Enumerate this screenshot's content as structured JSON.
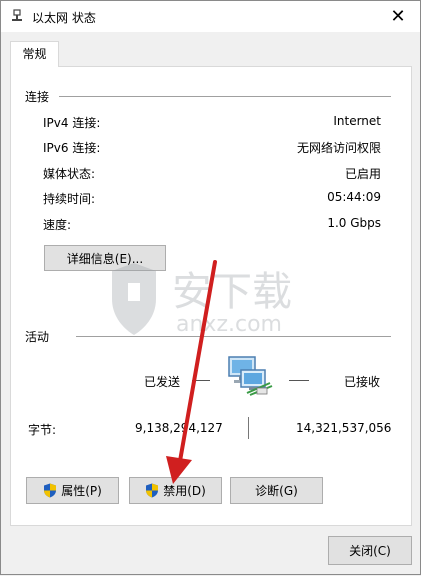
{
  "window": {
    "title": "以太网 状态",
    "close_glyph": "✕"
  },
  "tab": {
    "label": "常规"
  },
  "connection": {
    "section_title": "连接",
    "rows": [
      {
        "label": "IPv4 连接:",
        "value": "Internet"
      },
      {
        "label": "IPv6 连接:",
        "value": "无网络访问权限"
      },
      {
        "label": "媒体状态:",
        "value": "已启用"
      },
      {
        "label": "持续时间:",
        "value": "05:44:09"
      },
      {
        "label": "速度:",
        "value": "1.0 Gbps"
      }
    ],
    "details_button": "详细信息(E)..."
  },
  "activity": {
    "section_title": "活动",
    "sent_label": "已发送",
    "received_label": "已接收",
    "bytes_label": "字节:",
    "bytes_sent": "9,138,294,127",
    "bytes_received": "14,321,537,056"
  },
  "buttons": {
    "properties": "属性(P)",
    "disable": "禁用(D)",
    "diagnose": "诊断(G)",
    "close": "关闭(C)"
  },
  "watermark": {
    "text": "安下载",
    "subtext": "anxz.com"
  },
  "icons": {
    "network": "network-computers-icon",
    "shield": "uac-shield-icon"
  },
  "colors": {
    "arrow": "#d01f1f",
    "shield_blue": "#1f5fbf",
    "shield_yellow": "#f2c200"
  }
}
